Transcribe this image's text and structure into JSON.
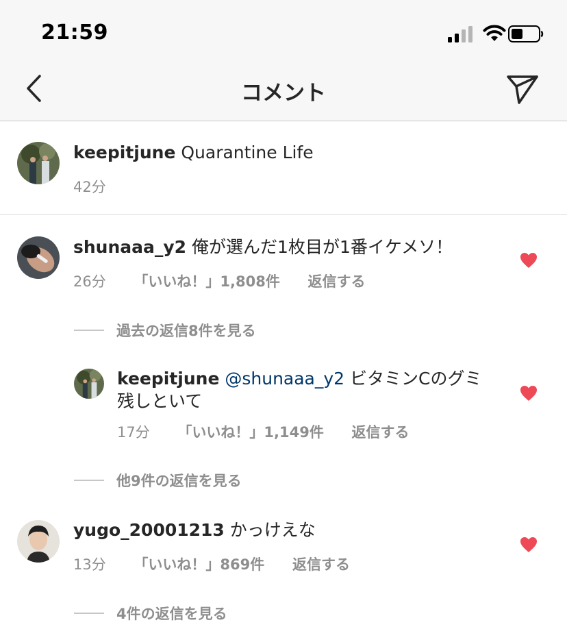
{
  "status_bar": {
    "time": "21:59"
  },
  "header": {
    "title": "コメント"
  },
  "caption": {
    "username": "keepitjune",
    "text": "Quarantine Life",
    "time": "42分"
  },
  "comments": [
    {
      "username": "shunaaa_y2",
      "text": "俺が選んだ1枚目が1番イケメソ！",
      "time": "26分",
      "likes": "「いいね！」1,808件",
      "reply": "返信する",
      "view_replies": "過去の返信8件を見る",
      "liked": true
    },
    {
      "username": "keepitjune",
      "mention": "@shunaaa_y2",
      "text_line1": "ビタミンCのグミ",
      "text_line2": "残しといて",
      "time": "17分",
      "likes": "「いいね！」1,149件",
      "reply": "返信する",
      "view_replies": "他9件の返信を見る",
      "liked": true
    },
    {
      "username": "yugo_20001213",
      "text": "かっけえな",
      "time": "13分",
      "likes": "「いいね！」869件",
      "reply": "返信する",
      "view_replies": "4件の返信を見る",
      "liked": true
    }
  ],
  "colors": {
    "heart": "#ed4956",
    "mention": "#00376b",
    "meta": "#8e8e8e",
    "header_bg": "#f7f7f7"
  },
  "icons": [
    "signal-icon",
    "wifi-icon",
    "battery-icon",
    "back-chevron-icon",
    "direct-share-icon",
    "heart-icon"
  ]
}
